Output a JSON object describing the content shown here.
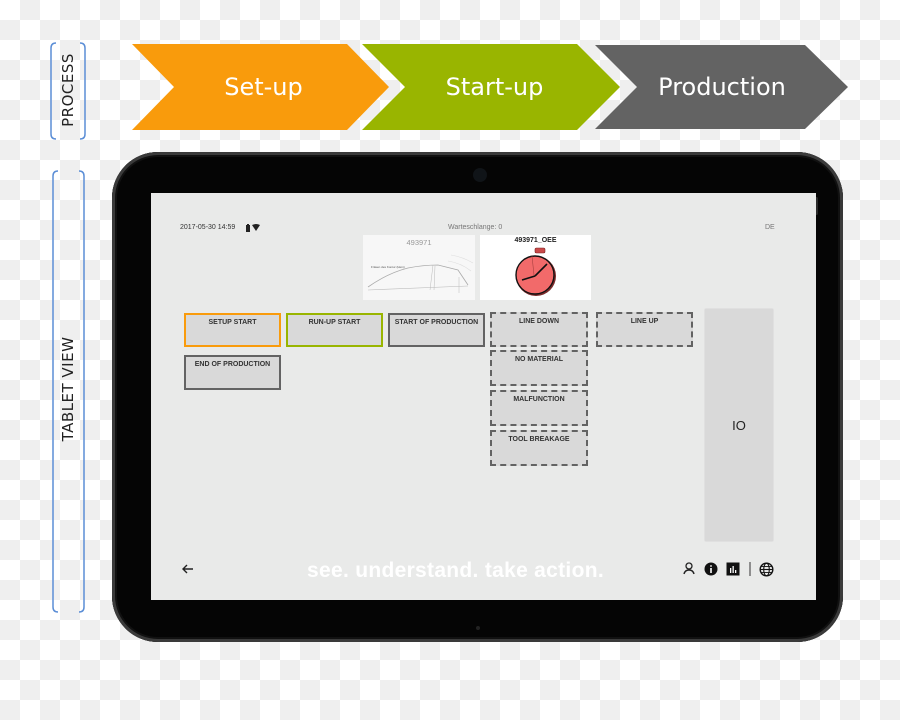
{
  "side_labels": {
    "process": "PROCESS",
    "tablet_view": "TABLET VIEW"
  },
  "process_steps": [
    {
      "label": "Set-up",
      "color": "#F99B0C"
    },
    {
      "label": "Start-up",
      "color": "#99B500"
    },
    {
      "label": "Production",
      "color": "#636363"
    }
  ],
  "status_bar": {
    "datetime": "2017-05-30 14:59",
    "battery_icon": "battery-icon",
    "wifi_icon": "wifi-icon",
    "queue": "Warteschlange: 0",
    "language": "DE"
  },
  "thumbnails": [
    {
      "label": "493971",
      "image": "part-drawing"
    },
    {
      "label": "493971_OEE",
      "image": "stopwatch-icon"
    }
  ],
  "thumbnail_caption": "Fräsen des Kontur ... (klein)",
  "buttons": {
    "setup_start": "SETUP START",
    "runup_start": "RUN-UP START",
    "start_of_production": "START OF PRODUCTION",
    "end_of_production": "END OF PRODUCTION",
    "line_down": "LINE DOWN",
    "no_material": "NO MATERIAL",
    "malfunction": "MALFUNCTION",
    "tool_breakage": "TOOL BREAKAGE",
    "line_up": "LINE UP"
  },
  "colors": {
    "setup": "#F99B0C",
    "runup": "#99B500",
    "production": "#636363"
  },
  "io_panel": "IO",
  "footer": {
    "back_icon": "arrow-left-icon",
    "tagline": "see. understand. take action.",
    "icons": [
      "user-icon",
      "info-icon",
      "chart-icon",
      "globe-icon"
    ]
  }
}
